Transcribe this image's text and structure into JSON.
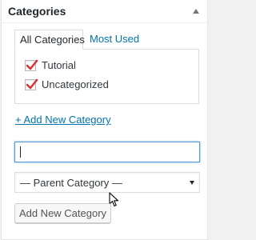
{
  "panel": {
    "title": "Categories",
    "toggle_icon": "triangle-up-icon"
  },
  "tabs": [
    {
      "label": "All Categories",
      "active": true
    },
    {
      "label": "Most Used",
      "active": false
    }
  ],
  "categories": [
    {
      "label": "Tutorial",
      "checked": true
    },
    {
      "label": "Uncategorized",
      "checked": true
    }
  ],
  "add_new_link": "+ Add New Category",
  "new_category_input": {
    "value": "",
    "placeholder": ""
  },
  "parent_select": {
    "selected": "— Parent Category —"
  },
  "add_button": "Add New Category",
  "colors": {
    "link": "#0073aa",
    "checkmark": "#d63638",
    "focus": "#5b9dd9"
  }
}
